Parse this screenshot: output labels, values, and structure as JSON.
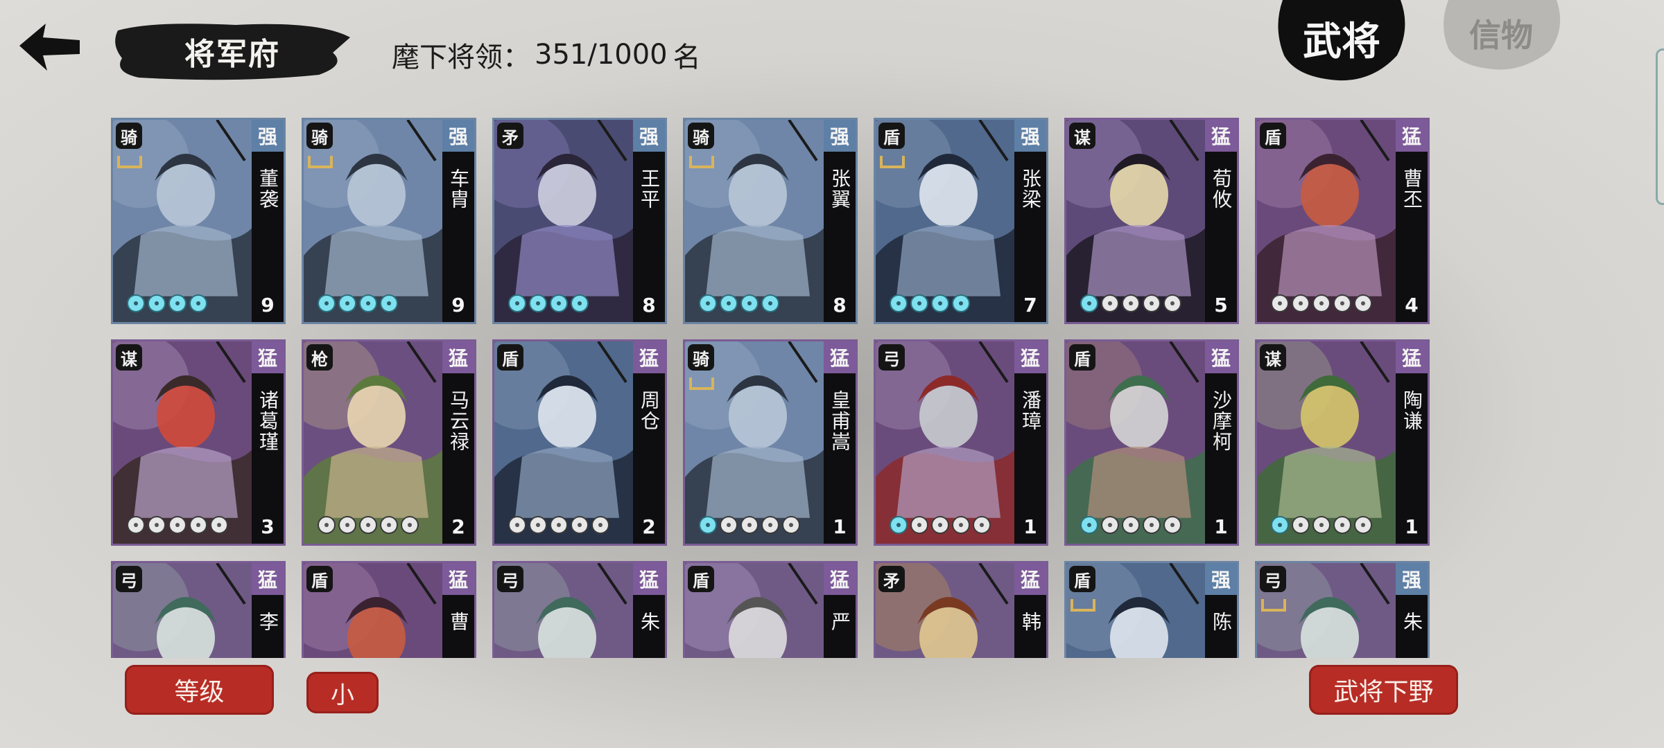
{
  "header": {
    "title": "将军府",
    "count_label": "麾下将领：",
    "count_value": "351/1000",
    "count_unit": "名"
  },
  "tabs": [
    {
      "label": "武将",
      "active": true
    },
    {
      "label": "信物",
      "active": false
    }
  ],
  "cards": [
    {
      "type": "骑",
      "grade": "强",
      "name": "董袭",
      "level": "9",
      "stars_on": 4,
      "stars_total": 4,
      "quality": "blue",
      "art": "cavalry"
    },
    {
      "type": "骑",
      "grade": "强",
      "name": "车胄",
      "level": "9",
      "stars_on": 4,
      "stars_total": 4,
      "quality": "blue",
      "art": "cavalry"
    },
    {
      "type": "矛",
      "grade": "强",
      "name": "王平",
      "level": "8",
      "stars_on": 4,
      "stars_total": 4,
      "quality": "blue",
      "art": "spear"
    },
    {
      "type": "骑",
      "grade": "强",
      "name": "张翼",
      "level": "8",
      "stars_on": 4,
      "stars_total": 4,
      "quality": "blue",
      "art": "cavalry"
    },
    {
      "type": "盾",
      "grade": "强",
      "name": "张梁",
      "level": "7",
      "stars_on": 4,
      "stars_total": 4,
      "quality": "blue",
      "art": "shield"
    },
    {
      "type": "谋",
      "grade": "猛",
      "name": "荀攸",
      "level": "5",
      "stars_on": 1,
      "stars_total": 5,
      "quality": "purple",
      "art": "strategist"
    },
    {
      "type": "盾",
      "grade": "猛",
      "name": "曹丕",
      "level": "4",
      "stars_on": 0,
      "stars_total": 5,
      "quality": "purple",
      "art": "lord"
    },
    {
      "type": "谋",
      "grade": "猛",
      "name": "诸葛瑾",
      "level": "3",
      "stars_on": 0,
      "stars_total": 5,
      "quality": "purple",
      "art": "scholar"
    },
    {
      "type": "枪",
      "grade": "猛",
      "name": "马云禄",
      "level": "2",
      "stars_on": 0,
      "stars_total": 5,
      "quality": "purple",
      "art": "lady"
    },
    {
      "type": "盾",
      "grade": "猛",
      "name": "周仓",
      "level": "2",
      "stars_on": 0,
      "stars_total": 5,
      "quality": "purple",
      "art": "shield"
    },
    {
      "type": "骑",
      "grade": "猛",
      "name": "皇甫嵩",
      "level": "1",
      "stars_on": 1,
      "stars_total": 5,
      "quality": "purple",
      "art": "cavalry"
    },
    {
      "type": "弓",
      "grade": "猛",
      "name": "潘璋",
      "level": "1",
      "stars_on": 1,
      "stars_total": 5,
      "quality": "purple",
      "art": "archer"
    },
    {
      "type": "盾",
      "grade": "猛",
      "name": "沙摩柯",
      "level": "1",
      "stars_on": 1,
      "stars_total": 5,
      "quality": "purple",
      "art": "barbarian"
    },
    {
      "type": "谋",
      "grade": "猛",
      "name": "陶谦",
      "level": "1",
      "stars_on": 1,
      "stars_total": 5,
      "quality": "purple",
      "art": "elder"
    },
    {
      "type": "弓",
      "grade": "猛",
      "name": "李",
      "level": "",
      "stars_on": 0,
      "stars_total": 0,
      "quality": "purple",
      "art": "archer2"
    },
    {
      "type": "盾",
      "grade": "猛",
      "name": "曹",
      "level": "",
      "stars_on": 0,
      "stars_total": 0,
      "quality": "purple",
      "art": "lord"
    },
    {
      "type": "弓",
      "grade": "猛",
      "name": "朱",
      "level": "",
      "stars_on": 0,
      "stars_total": 0,
      "quality": "purple",
      "art": "archer2"
    },
    {
      "type": "盾",
      "grade": "猛",
      "name": "严",
      "level": "",
      "stars_on": 0,
      "stars_total": 0,
      "quality": "purple",
      "art": "old"
    },
    {
      "type": "矛",
      "grade": "猛",
      "name": "韩",
      "level": "",
      "stars_on": 0,
      "stars_total": 0,
      "quality": "purple",
      "art": "helm"
    },
    {
      "type": "盾",
      "grade": "强",
      "name": "陈",
      "level": "",
      "stars_on": 0,
      "stars_total": 0,
      "quality": "blue",
      "art": "shield"
    },
    {
      "type": "弓",
      "grade": "强",
      "name": "朱",
      "level": "",
      "stars_on": 0,
      "stars_total": 0,
      "quality": "blue",
      "art": "archer2"
    }
  ],
  "buttons": {
    "sort_level": "等级",
    "sort_order": "小",
    "dismiss": "武将下野"
  },
  "colors": {
    "blue_quality": "#5e7fa6",
    "purple_quality": "#7d5a99",
    "red_button": "#b72d26",
    "active_star": "#7fe1ef"
  },
  "icons": {
    "back": "back-arrow-icon",
    "level_pip": "jade-pip-icon"
  }
}
